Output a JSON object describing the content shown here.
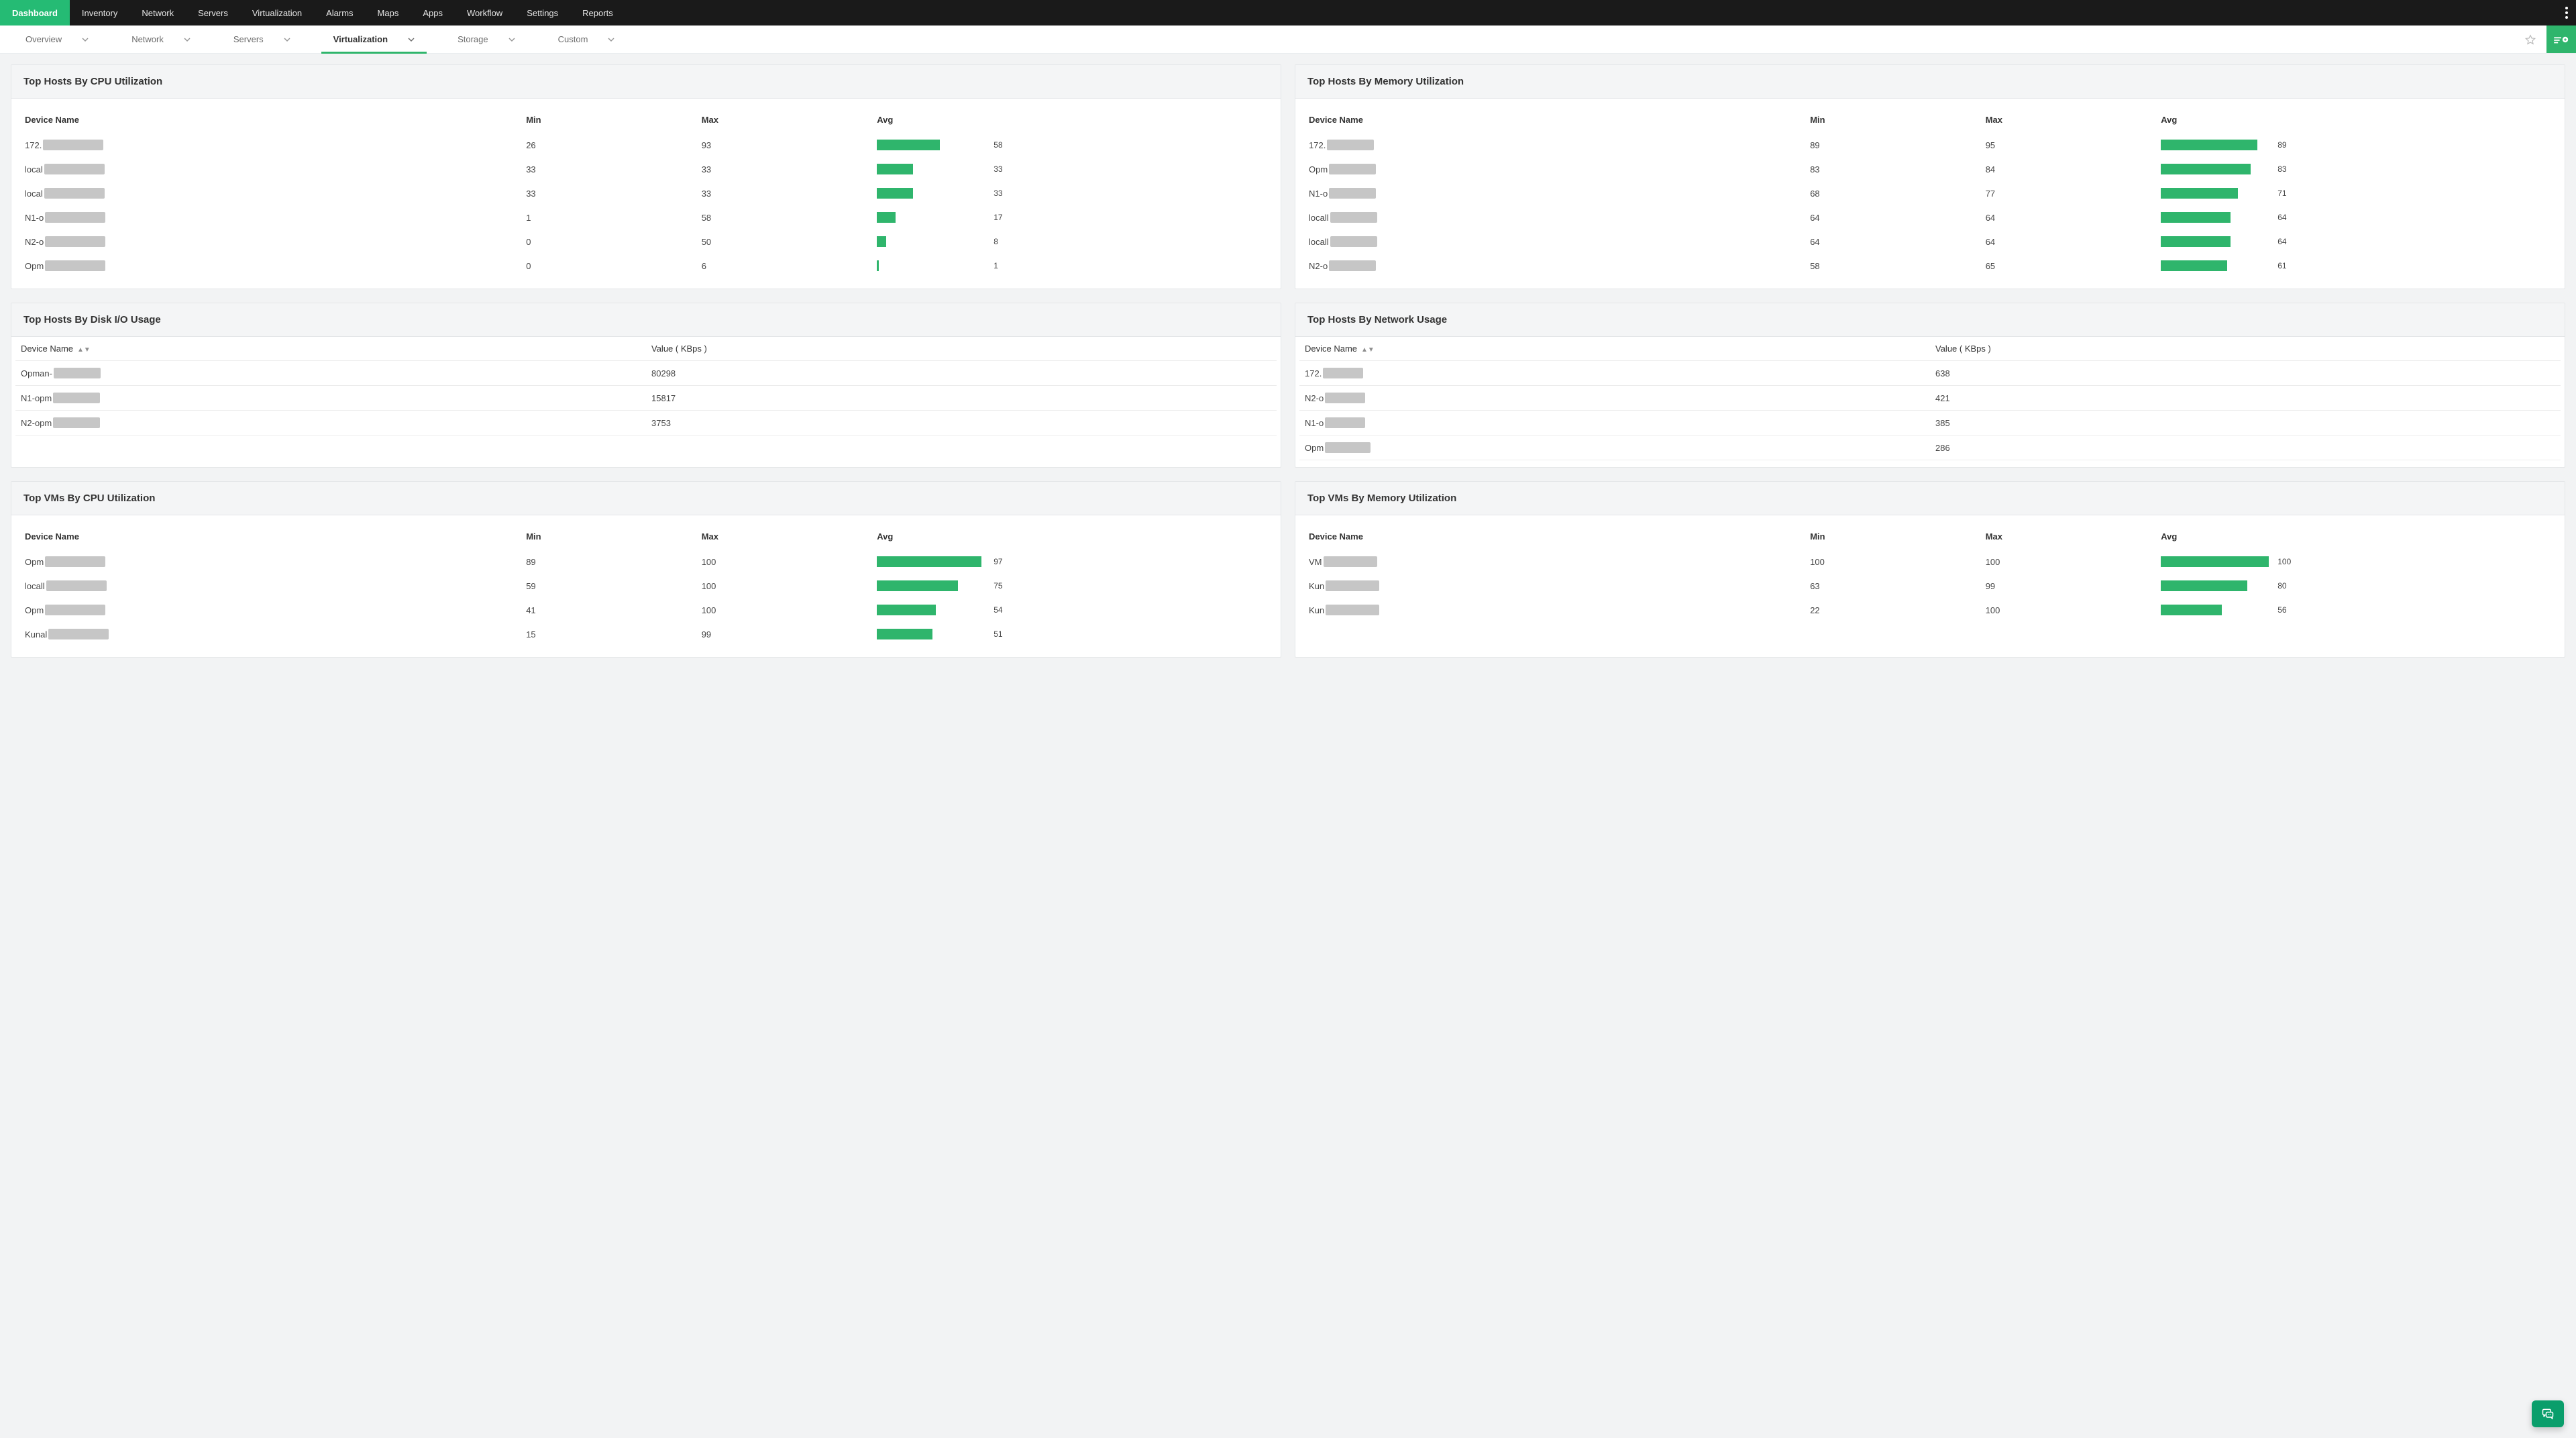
{
  "topnav": {
    "items": [
      {
        "label": "Dashboard",
        "active": true
      },
      {
        "label": "Inventory",
        "active": false
      },
      {
        "label": "Network",
        "active": false
      },
      {
        "label": "Servers",
        "active": false
      },
      {
        "label": "Virtualization",
        "active": false
      },
      {
        "label": "Alarms",
        "active": false
      },
      {
        "label": "Maps",
        "active": false
      },
      {
        "label": "Apps",
        "active": false
      },
      {
        "label": "Workflow",
        "active": false
      },
      {
        "label": "Settings",
        "active": false
      },
      {
        "label": "Reports",
        "active": false
      }
    ]
  },
  "subnav": {
    "items": [
      {
        "label": "Overview",
        "active": false
      },
      {
        "label": "Network",
        "active": false
      },
      {
        "label": "Servers",
        "active": false
      },
      {
        "label": "Virtualization",
        "active": true
      },
      {
        "label": "Storage",
        "active": false
      },
      {
        "label": "Custom",
        "active": false
      }
    ]
  },
  "columns": {
    "device": "Device Name",
    "min": "Min",
    "max": "Max",
    "avg": "Avg",
    "value_kbps": "Value ( KBps )"
  },
  "panels": {
    "hosts_cpu": {
      "title": "Top Hosts By CPU Utilization",
      "rows": [
        {
          "prefix": "172.",
          "mask_w": 90,
          "min": "26",
          "max": "93",
          "avg": 58
        },
        {
          "prefix": "local",
          "mask_w": 90,
          "min": "33",
          "max": "33",
          "avg": 33
        },
        {
          "prefix": "local",
          "mask_w": 90,
          "min": "33",
          "max": "33",
          "avg": 33
        },
        {
          "prefix": "N1-o",
          "mask_w": 90,
          "min": "1",
          "max": "58",
          "avg": 17
        },
        {
          "prefix": "N2-o",
          "mask_w": 90,
          "min": "0",
          "max": "50",
          "avg": 8
        },
        {
          "prefix": "Opm",
          "mask_w": 90,
          "min": "0",
          "max": "6",
          "avg": 1
        }
      ]
    },
    "hosts_mem": {
      "title": "Top Hosts By Memory Utilization",
      "rows": [
        {
          "prefix": "172.",
          "mask_w": 70,
          "min": "89",
          "max": "95",
          "avg": 89
        },
        {
          "prefix": "Opm",
          "mask_w": 70,
          "min": "83",
          "max": "84",
          "avg": 83
        },
        {
          "prefix": "N1-o",
          "mask_w": 70,
          "min": "68",
          "max": "77",
          "avg": 71
        },
        {
          "prefix": "locall",
          "mask_w": 70,
          "min": "64",
          "max": "64",
          "avg": 64
        },
        {
          "prefix": "locall",
          "mask_w": 70,
          "min": "64",
          "max": "64",
          "avg": 64
        },
        {
          "prefix": "N2-o",
          "mask_w": 70,
          "min": "58",
          "max": "65",
          "avg": 61
        }
      ]
    },
    "hosts_disk": {
      "title": "Top Hosts By Disk I/O Usage",
      "rows": [
        {
          "prefix": "Opman-",
          "mask_w": 70,
          "value": "80298"
        },
        {
          "prefix": "N1-opm",
          "mask_w": 70,
          "value": "15817"
        },
        {
          "prefix": "N2-opm",
          "mask_w": 70,
          "value": "3753"
        }
      ]
    },
    "hosts_net": {
      "title": "Top Hosts By Network Usage",
      "rows": [
        {
          "prefix": "172.",
          "mask_w": 60,
          "value": "638"
        },
        {
          "prefix": "N2-o",
          "mask_w": 60,
          "value": "421"
        },
        {
          "prefix": "N1-o",
          "mask_w": 60,
          "value": "385"
        },
        {
          "prefix": "Opm",
          "mask_w": 68,
          "value": "286"
        }
      ]
    },
    "vms_cpu": {
      "title": "Top VMs By CPU Utilization",
      "rows": [
        {
          "prefix": "Opm",
          "mask_w": 90,
          "min": "89",
          "max": "100",
          "avg": 97
        },
        {
          "prefix": "locall",
          "mask_w": 90,
          "min": "59",
          "max": "100",
          "avg": 75
        },
        {
          "prefix": "Opm",
          "mask_w": 90,
          "min": "41",
          "max": "100",
          "avg": 54
        },
        {
          "prefix": "Kunal",
          "mask_w": 90,
          "min": "15",
          "max": "99",
          "avg": 51
        }
      ]
    },
    "vms_mem": {
      "title": "Top VMs By Memory Utilization",
      "rows": [
        {
          "prefix": "VM",
          "mask_w": 80,
          "min": "100",
          "max": "100",
          "avg": 100
        },
        {
          "prefix": "Kun",
          "mask_w": 80,
          "min": "63",
          "max": "99",
          "avg": 80
        },
        {
          "prefix": "Kun",
          "mask_w": 80,
          "min": "22",
          "max": "100",
          "avg": 56
        }
      ]
    }
  },
  "chart_data": [
    {
      "type": "bar",
      "title": "Top Hosts By CPU Utilization — Avg",
      "xlabel": "",
      "ylabel": "Avg %",
      "ylim": [
        0,
        100
      ],
      "categories": [
        "172.",
        "local",
        "local",
        "N1-o",
        "N2-o",
        "Opm"
      ],
      "values": [
        58,
        33,
        33,
        17,
        8,
        1
      ]
    },
    {
      "type": "bar",
      "title": "Top Hosts By Memory Utilization — Avg",
      "xlabel": "",
      "ylabel": "Avg %",
      "ylim": [
        0,
        100
      ],
      "categories": [
        "172.",
        "Opm",
        "N1-o",
        "locall",
        "locall",
        "N2-o"
      ],
      "values": [
        89,
        83,
        71,
        64,
        64,
        61
      ]
    },
    {
      "type": "bar",
      "title": "Top VMs By CPU Utilization — Avg",
      "xlabel": "",
      "ylabel": "Avg %",
      "ylim": [
        0,
        100
      ],
      "categories": [
        "Opm",
        "locall",
        "Opm",
        "Kunal"
      ],
      "values": [
        97,
        75,
        54,
        51
      ]
    },
    {
      "type": "bar",
      "title": "Top VMs By Memory Utilization — Avg",
      "xlabel": "",
      "ylabel": "Avg %",
      "ylim": [
        0,
        100
      ],
      "categories": [
        "VM",
        "Kun",
        "Kun"
      ],
      "values": [
        100,
        80,
        56
      ]
    },
    {
      "type": "table",
      "title": "Top Hosts By Disk I/O Usage",
      "categories": [
        "Opman-",
        "N1-opm",
        "N2-opm"
      ],
      "values": [
        80298,
        15817,
        3753
      ],
      "ylabel": "Value ( KBps )"
    },
    {
      "type": "table",
      "title": "Top Hosts By Network Usage",
      "categories": [
        "172.",
        "N2-o",
        "N1-o",
        "Opm"
      ],
      "values": [
        638,
        421,
        385,
        286
      ],
      "ylabel": "Value ( KBps )"
    }
  ]
}
